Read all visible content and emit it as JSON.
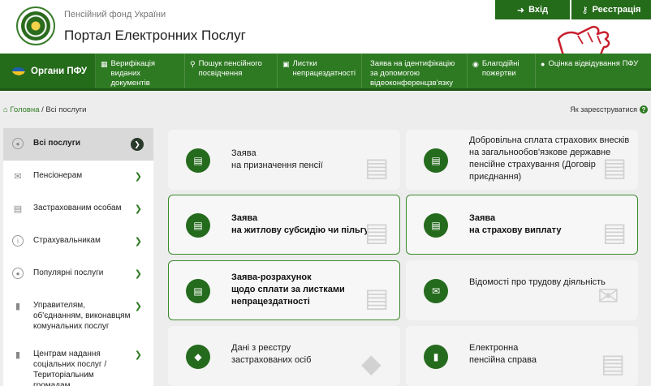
{
  "header": {
    "subtitle": "Пенсійний фонд України",
    "title": "Портал Електронних Послуг",
    "login_label": "Вхід",
    "register_label": "Реєстрація"
  },
  "nav": {
    "brand": "Органи ПФУ",
    "items": [
      {
        "label": "Верифікація виданих документів",
        "icon": "list-icon"
      },
      {
        "label": "Пошук пенсійного посвідчення",
        "icon": "search-icon"
      },
      {
        "label": "Листки непрацездатності",
        "icon": "camera-icon"
      },
      {
        "label": "Заява на ідентифікацію за допомогою відеоконференцзв'язку",
        "icon": ""
      },
      {
        "label": "Благодійні пожертви",
        "icon": "coins-icon"
      },
      {
        "label": "Оцінка відвідування ПФУ",
        "icon": "chat-icon"
      }
    ]
  },
  "breadcrumb": {
    "home": "Головна",
    "current": "Всі послуги"
  },
  "help": {
    "label": "Як зареєструватися"
  },
  "sidebar": {
    "items": [
      {
        "label": "Всі послуги",
        "icon": "target-icon"
      },
      {
        "label": "Пенсіонерам",
        "icon": "envelope-icon"
      },
      {
        "label": "Застрахованим особам",
        "icon": "document-icon"
      },
      {
        "label": "Страхувальникам",
        "icon": "info-icon"
      },
      {
        "label": "Популярні послуги",
        "icon": "target-icon"
      },
      {
        "label": "Управителям, об'єднанням, виконавцям комунальних послуг",
        "icon": "folder-icon"
      },
      {
        "label": "Центрам надання соціальних послуг / Територіальним громадам",
        "icon": "folder-icon"
      }
    ]
  },
  "cards": [
    {
      "lines": [
        "Заява",
        "на призначення пенсії"
      ],
      "bold": false,
      "icon": "document-icon"
    },
    {
      "lines": [
        "Добровільна сплата страхових внесків",
        "на загальнообов'язкове державне",
        "пенсійне страхування (Договір",
        "приєднання)"
      ],
      "bold": false,
      "icon": "document-icon"
    },
    {
      "lines": [
        "Заява",
        "на житлову субсидію чи пільгу"
      ],
      "bold": true,
      "icon": "document-icon"
    },
    {
      "lines": [
        "Заява",
        "на страхову виплату"
      ],
      "bold": true,
      "icon": "document-icon"
    },
    {
      "lines": [
        "Заява-розрахунок",
        "щодо сплати за листками",
        "непрацездатності"
      ],
      "bold": true,
      "icon": "document-icon"
    },
    {
      "lines": [
        "Відомості про трудову діяльність"
      ],
      "bold": false,
      "icon": "envelope-icon"
    },
    {
      "lines": [
        "Дані з реєстру",
        "застрахованих осіб"
      ],
      "bold": false,
      "icon": "shield-icon"
    },
    {
      "lines": [
        "Електронна",
        "пенсійна справа"
      ],
      "bold": false,
      "icon": "folder-icon"
    }
  ]
}
